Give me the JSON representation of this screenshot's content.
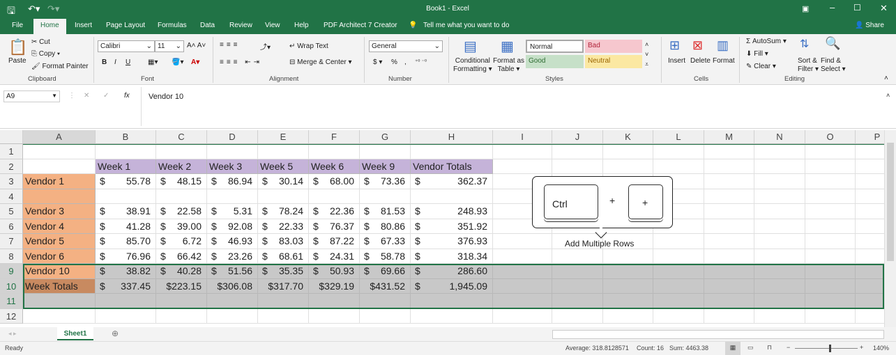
{
  "window": {
    "title": "Book1  -  Excel"
  },
  "menu": {
    "tabs": [
      "File",
      "Home",
      "Insert",
      "Page Layout",
      "Formulas",
      "Data",
      "Review",
      "View",
      "Help",
      "PDF Architect 7 Creator"
    ],
    "tell_me": "Tell me what you want to do",
    "share": "Share"
  },
  "ribbon": {
    "clipboard": {
      "paste": "Paste",
      "cut": "Cut",
      "copy": "Copy",
      "format_painter": "Format Painter",
      "label": "Clipboard"
    },
    "font": {
      "name": "Calibri",
      "size": "11",
      "bold": "B",
      "italic": "I",
      "underline": "U",
      "label": "Font"
    },
    "alignment": {
      "wrap": "Wrap Text",
      "merge": "Merge & Center",
      "label": "Alignment"
    },
    "number": {
      "format": "General",
      "currency": "$",
      "percent": "%",
      "comma": ",",
      "label": "Number"
    },
    "styles": {
      "conditional": "Conditional",
      "conditional2": "Formatting",
      "format_table": "Format as",
      "format_table2": "Table",
      "normal": "Normal",
      "bad": "Bad",
      "good": "Good",
      "neutral": "Neutral",
      "label": "Styles"
    },
    "cells": {
      "insert": "Insert",
      "delete": "Delete",
      "format": "Format",
      "label": "Cells"
    },
    "editing": {
      "autosum": "AutoSum",
      "fill": "Fill",
      "clear": "Clear",
      "sort": "Sort &",
      "sort2": "Filter",
      "find": "Find &",
      "find2": "Select",
      "label": "Editing"
    }
  },
  "formula_bar": {
    "name_box": "A9",
    "fx": "fx",
    "value": "Vendor 10"
  },
  "sheet": {
    "columns": [
      "A",
      "B",
      "C",
      "D",
      "E",
      "F",
      "G",
      "H",
      "I",
      "J",
      "K",
      "L",
      "M",
      "N",
      "O",
      "P"
    ],
    "rows": [
      "1",
      "2",
      "3",
      "4",
      "5",
      "6",
      "7",
      "8",
      "9",
      "10",
      "11",
      "12"
    ],
    "headers": [
      "Week 1",
      "Week 2",
      "Week 3",
      "Week 5",
      "Week 6",
      "Week 9",
      "Vendor Totals"
    ],
    "data": [
      {
        "row": 3,
        "label": "Vendor 1",
        "values": [
          "55.78",
          "48.15",
          "86.94",
          "30.14",
          "68.00",
          "73.36",
          "362.37"
        ]
      },
      {
        "row": 5,
        "label": "Vendor 3",
        "values": [
          "38.91",
          "22.58",
          "5.31",
          "78.24",
          "22.36",
          "81.53",
          "248.93"
        ]
      },
      {
        "row": 6,
        "label": "Vendor 4",
        "values": [
          "41.28",
          "39.00",
          "92.08",
          "22.33",
          "76.37",
          "80.86",
          "351.92"
        ]
      },
      {
        "row": 7,
        "label": "Vendor 5",
        "values": [
          "85.70",
          "6.72",
          "46.93",
          "83.03",
          "87.22",
          "67.33",
          "376.93"
        ]
      },
      {
        "row": 8,
        "label": "Vendor 6",
        "values": [
          "76.96",
          "66.42",
          "23.26",
          "68.61",
          "24.31",
          "58.78",
          "318.34"
        ]
      },
      {
        "row": 9,
        "label": "Vendor 10",
        "values": [
          "38.82",
          "40.28",
          "51.56",
          "35.35",
          "50.93",
          "69.66",
          "286.60"
        ]
      },
      {
        "row": 10,
        "label": "Week Totals",
        "values": [
          "337.45",
          "223.15",
          "306.08",
          "317.70",
          "329.19",
          "431.52",
          "1,945.09"
        ]
      }
    ],
    "currency": "$",
    "colors": {
      "header_fill": "#c5b3d9",
      "label_fill": "#f4b183",
      "totals_label_fill": "#c88a60",
      "selection_fill": "#c8c8c8"
    }
  },
  "callout": {
    "key1": "Ctrl",
    "plus": "+",
    "key2": "+",
    "caption": "Add Multiple Rows"
  },
  "sheet_tabs": {
    "active": "Sheet1"
  },
  "status": {
    "ready": "Ready",
    "average": "Average: 318.8128571",
    "count": "Count: 16",
    "sum": "Sum: 4463.38",
    "zoom": "140%"
  }
}
